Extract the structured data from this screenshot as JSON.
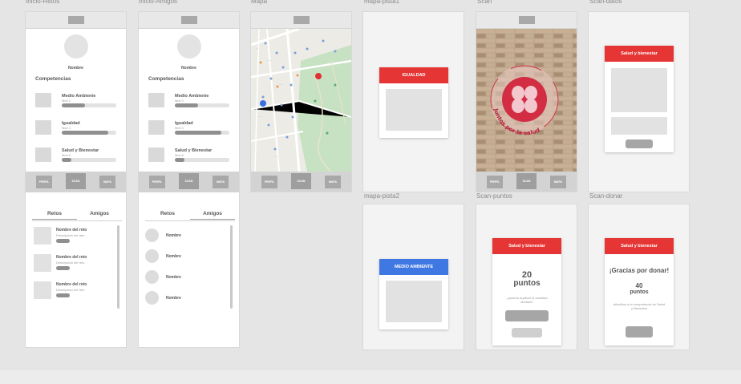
{
  "colors": {
    "red": "#e53535",
    "blue": "#4078e3",
    "canvas": "#e5e5e5",
    "gray": "#9e9e9e"
  },
  "frame_labels": {
    "inicio_retos": "Inicio-Retos",
    "inicio_amigos": "Inicio-Amigos",
    "mapa": "Mapa",
    "mapa_pista1": "mapa-pista1",
    "scan": "Scan",
    "scan_datos": "Scan-datos",
    "mapa_pista2": "mapa-pista2",
    "scan_puntos": "Scan-puntos",
    "scan_donar": "Scan-donar"
  },
  "profile": {
    "name": "Nombre",
    "section_title": "Competencias",
    "competencies": [
      {
        "name": "Medio Ambiente",
        "level": "Nivel 3",
        "progress": 0.42
      },
      {
        "name": "Igualdad",
        "level": "Nivel 4",
        "progress": 0.86
      },
      {
        "name": "Salud y Bienestar",
        "level": "Nivel 6",
        "progress": 0.18
      }
    ]
  },
  "nav": {
    "profile": "PERFIL",
    "scan": "SCAN",
    "map": "MAPA"
  },
  "tabs": {
    "retos": "Retos",
    "amigos": "Amigos"
  },
  "retos": [
    {
      "name": "Nombre del reto",
      "desc": "Descripción del reto"
    },
    {
      "name": "Nombre del reto",
      "desc": "Descripción del reto"
    },
    {
      "name": "Nombre del reto",
      "desc": "Descripción del reto"
    }
  ],
  "amigos": [
    "Nombre",
    "Nombre",
    "Nombre",
    "Nombre"
  ],
  "map": {
    "marker_user": "#3a6ee0",
    "marker_goal": "#e03131"
  },
  "scan": {
    "logo_text": "Juntos por la salud"
  },
  "cards": {
    "igualdad": "IGUALDAD",
    "medio_ambiente": "MEDIO AMBIENTE",
    "salud_datos": "Salud y bienestar",
    "salud_puntos": "Salud y bienestar",
    "salud_donar": "Salud y bienestar"
  },
  "puntos": {
    "number": "20",
    "unit": "puntos",
    "question": "¿quieres duplicar la cantidad donada?"
  },
  "donar": {
    "thanks": "¡Gracias por donar!",
    "number": "40",
    "unit": "puntos",
    "note": "añadidos a la competencia de Salud y Bienestar"
  }
}
